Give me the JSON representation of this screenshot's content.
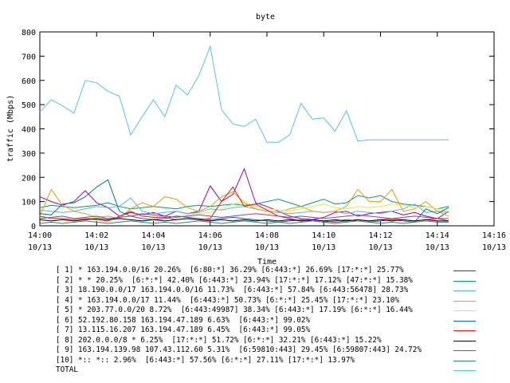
{
  "chart_data": {
    "type": "line",
    "title": "byte",
    "xlabel": "Time",
    "ylabel": "traffic (Mbps)",
    "ylim": [
      0,
      800
    ],
    "y_ticks": [
      "0",
      "100",
      "200",
      "300",
      "400",
      "500",
      "600",
      "700",
      "800"
    ],
    "xlim": [
      0,
      16
    ],
    "x_ticks": [
      {
        "value": 0,
        "line1": "14:00",
        "line2": "10/13"
      },
      {
        "value": 2,
        "line1": "14:02",
        "line2": "10/13"
      },
      {
        "value": 4,
        "line1": "14:04",
        "line2": "10/13"
      },
      {
        "value": 6,
        "line1": "14:06",
        "line2": "10/13"
      },
      {
        "value": 8,
        "line1": "14:08",
        "line2": "10/13"
      },
      {
        "value": 10,
        "line1": "14:10",
        "line2": "10/13"
      },
      {
        "value": 12,
        "line1": "14:12",
        "line2": "10/13"
      },
      {
        "value": 14,
        "line1": "14:14",
        "line2": "10/13"
      },
      {
        "value": 16,
        "line1": "14:16",
        "line2": "10/13"
      }
    ],
    "x_unit": "minutes after 14:00",
    "x": [
      0,
      0.4,
      0.8,
      1.2,
      1.6,
      2,
      2.4,
      2.8,
      3.2,
      3.6,
      4,
      4.4,
      4.8,
      5.2,
      5.6,
      6,
      6.4,
      6.8,
      7.2,
      7.6,
      8,
      8.4,
      8.8,
      9.2,
      9.6,
      10,
      10.4,
      10.8,
      11.2,
      11.6,
      12,
      12.4,
      12.8,
      13.2,
      13.6,
      14,
      14.4
    ],
    "series": [
      {
        "name": "[ 1] * 163.194.0.0/16 20.26%  [6:80:*] 36.29% [6:443:*] 26.69% [17:*:*] 25.77%",
        "color": "#9400d3",
        "values": [
          120,
          100,
          85,
          100,
          145,
          95,
          75,
          40,
          55,
          45,
          55,
          40,
          60,
          50,
          60,
          165,
          100,
          130,
          235,
          95,
          80,
          60,
          40,
          30,
          25,
          35,
          55,
          60,
          40,
          50,
          55,
          60,
          45,
          55,
          40,
          30,
          60
        ]
      },
      {
        "name": "[ 2] * * 20.25%  [6:*:*] 42.40% [6:443:*] 23.94% [17:*:*] 17.12% [47:*:*] 15.38%",
        "color": "#009e73",
        "values": [
          75,
          85,
          80,
          75,
          80,
          85,
          95,
          80,
          70,
          75,
          80,
          75,
          70,
          80,
          85,
          80,
          85,
          90,
          85,
          90,
          100,
          110,
          95,
          80,
          95,
          110,
          90,
          95,
          125,
          115,
          125,
          100,
          90,
          85,
          80,
          70,
          80
        ]
      },
      {
        "name": "[ 3] 18.190.0.0/17 163.194.0.0/16 11.73%  [6:443:*] 57.84% [6:443:56478] 28.73%",
        "color": "#56b4e9",
        "values": [
          65,
          60,
          55,
          60,
          70,
          80,
          75,
          80,
          115,
          60,
          50,
          55,
          60,
          50,
          55,
          70,
          65,
          75,
          80,
          70,
          60,
          55,
          50,
          55,
          60,
          55,
          60,
          50,
          60,
          55,
          50,
          60,
          70,
          90,
          55,
          60,
          55
        ]
      },
      {
        "name": "[ 4] * 163.194.0.0/17 11.44%  [6:443:*] 50.73% [6:*:*] 25.45% [17:*:*] 23.10%",
        "color": "#e69f00",
        "values": [
          40,
          150,
          85,
          60,
          50,
          35,
          40,
          30,
          70,
          95,
          80,
          120,
          110,
          75,
          60,
          80,
          120,
          140,
          95,
          70,
          60,
          55,
          70,
          80,
          60,
          55,
          60,
          80,
          150,
          100,
          100,
          150,
          60,
          70,
          100,
          60,
          40
        ]
      },
      {
        "name": "[ 5] * 203.77.0.0/20 8.72%  [6:443:49987] 38.34% [6:443:*] 17.19% [6:*:*] 16.44%",
        "color": "#f0e442",
        "values": [
          30,
          35,
          30,
          25,
          30,
          35,
          30,
          35,
          40,
          45,
          40,
          35,
          40,
          45,
          50,
          55,
          70,
          90,
          100,
          80,
          70,
          65,
          60,
          70,
          80,
          90,
          75,
          70,
          80,
          75,
          80,
          90,
          85,
          75,
          80,
          70,
          60
        ]
      },
      {
        "name": "[ 6] 52.192.80.158 163.194.47.189 6.63%  [6:443:*] 99.02%",
        "color": "#0072b2",
        "values": [
          50,
          45,
          90,
          95,
          120,
          160,
          190,
          60,
          40,
          30,
          25,
          30,
          40,
          35,
          30,
          25,
          30,
          35,
          30,
          25,
          20,
          15,
          20,
          25,
          20,
          15,
          20,
          25,
          20,
          15,
          20,
          25,
          20,
          15,
          70,
          50,
          75
        ]
      },
      {
        "name": "[ 7] 13.115.16.207 163.194.47.189 6.45%  [6:443:*] 99.05%",
        "color": "#e51e10",
        "values": [
          40,
          30,
          30,
          25,
          30,
          25,
          20,
          40,
          60,
          40,
          35,
          35,
          25,
          30,
          25,
          30,
          100,
          160,
          80,
          90,
          65,
          40,
          30,
          20,
          25,
          20,
          15,
          20,
          25,
          20,
          25,
          30,
          25,
          20,
          25,
          30,
          20
        ]
      },
      {
        "name": "[ 8] 202.0.0.0/8 * 6.25%  [17:*:*] 51.72% [6:*:*] 32.21% [6:443:*] 15.22%",
        "color": "#000000",
        "values": [
          25,
          20,
          25,
          20,
          25,
          30,
          25,
          30,
          25,
          20,
          25,
          20,
          25,
          30,
          25,
          20,
          25,
          20,
          25,
          20,
          25,
          20,
          25,
          20,
          25,
          20,
          25,
          20,
          25,
          20,
          25,
          20,
          25,
          20,
          25,
          20,
          20
        ]
      },
      {
        "name": "[ 9] 163.194.139.98 107.43.112.60 5.31%  [6:59810:443] 29.45% [6:59807:443] 24.72%",
        "color": "#8f3fbf",
        "values": [
          30,
          35,
          40,
          30,
          35,
          40,
          30,
          35,
          40,
          50,
          45,
          40,
          35,
          40,
          45,
          40,
          35,
          40,
          45,
          50,
          45,
          40,
          35,
          40,
          35,
          30,
          35,
          40,
          45,
          40,
          35,
          30,
          35,
          40,
          35,
          30,
          30
        ]
      },
      {
        "name": "[10] *:: *:: 2.96%  [6:443:*] 57.56% [6:*:*] 27.11% [17:*:*] 13.97%",
        "color": "#2a8a6a",
        "values": [
          10,
          15,
          10,
          15,
          20,
          15,
          10,
          15,
          20,
          15,
          10,
          15,
          10,
          15,
          20,
          15,
          10,
          15,
          20,
          15,
          10,
          15,
          10,
          15,
          20,
          15,
          10,
          15,
          20,
          15,
          10,
          15,
          10,
          15,
          20,
          15,
          15
        ]
      },
      {
        "name": "TOTAL",
        "color": "#56c4e9",
        "values": [
          470,
          520,
          495,
          465,
          600,
          590,
          555,
          535,
          375,
          450,
          520,
          450,
          580,
          540,
          620,
          740,
          480,
          420,
          410,
          440,
          345,
          345,
          375,
          505,
          440,
          445,
          390,
          475,
          350,
          355,
          355,
          355,
          355,
          355,
          355,
          355,
          355
        ]
      }
    ]
  }
}
